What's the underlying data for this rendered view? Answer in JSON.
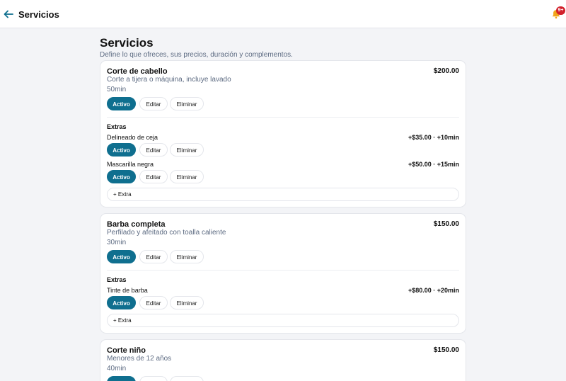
{
  "header": {
    "title": "Servicios",
    "notifications_badge": "9+"
  },
  "page": {
    "title": "Servicios",
    "subtitle": "Define lo que ofreces, sus precios, duración y complementos."
  },
  "labels": {
    "active": "Activo",
    "edit": "Editar",
    "delete": "Eliminar",
    "extras": "Extras",
    "add_extra": "+ Extra"
  },
  "services": [
    {
      "name": "Corte de cabello",
      "description": "Corte a tijera o máquina, incluye lavado",
      "duration": "50min",
      "price": "$200.00",
      "extras": [
        {
          "name": "Delineado de ceja",
          "price": "+$35.00 · +10min"
        },
        {
          "name": "Mascarilla negra",
          "price": "+$50.00 · +15min"
        }
      ]
    },
    {
      "name": "Barba completa",
      "description": "Perfilado y afeitado con toalla caliente",
      "duration": "30min",
      "price": "$150.00",
      "extras": [
        {
          "name": "Tinte de barba",
          "price": "+$80.00 · +20min"
        }
      ]
    },
    {
      "name": "Corte niño",
      "description": "Menores de 12 años",
      "duration": "40min",
      "price": "$150.00",
      "extras": []
    }
  ]
}
